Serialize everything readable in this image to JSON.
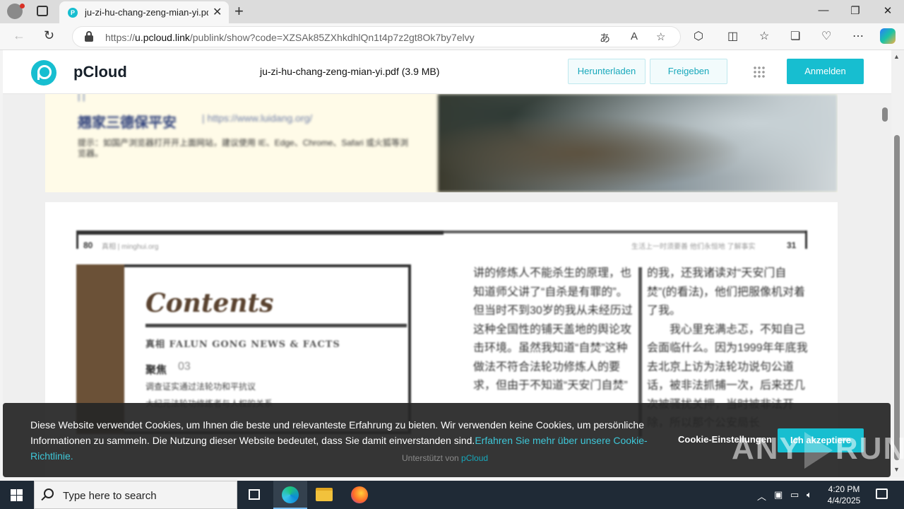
{
  "browser": {
    "tab_title": "ju-zi-hu-chang-zeng-mian-yi.pdf",
    "url_prefix": "https://",
    "url_domain": "u.pcloud.link",
    "url_rest": "/publink/show?code=XZSAk85ZXhkdhlQn1t4p7z2gt8Ok7by7elvy"
  },
  "header": {
    "logo_text": "pCloud",
    "file_title": "ju-zi-hu-chang-zeng-mian-yi.pdf (3.9 MB)",
    "download_label": "Herunterladen",
    "share_label": "Freigeben",
    "signin_label": "Anmelden"
  },
  "document": {
    "page1": {
      "line1": "|   |",
      "big_title": "翘家三德保平安",
      "url": "| https://www.luidang.org/",
      "note": "提示：如国产浏览器打开开上面网站，建议使用 IE、Edge、Chrome、Safari 或火狐等浏览器。"
    },
    "page2": {
      "page_num_left": "80",
      "header_left": "真相 | minghui.org",
      "header_right": "生活上一时须要善  他们永恒地 了解事实",
      "page_num_right": "31",
      "contents_title": "Contents",
      "subtitle": "真相 FALUN GONG NEWS & FACTS",
      "section": "聚焦",
      "section_num": "03",
      "item1": "调查证实通过法轮功和平抗议",
      "item2": "大纪元法轮功修炼者与人权的关系",
      "col1": "讲的修炼人不能杀生的原理，也知道师父讲了“自杀是有罪的”。但当时不到30岁的我从未经历过这种全国性的铺天盖地的舆论攻击环境。虽然我知道“自焚”这种做法不符合法轮功修炼人的要求，但由于不知道“天安门自焚”",
      "col2": "的我，还我诸读对“天安门自焚”(的看法)，他们把服像机对着了我。\n　　我心里充满忐忑，不知自己会面临什么。因为1999年年底我去北京上访为法轮功说句公道话，被非法抓捕一次，后来还几次被骚扰关押，当时被非法开除，所以那个公安局长"
    },
    "powered_prefix": "Unterstützt von",
    "powered_brand": "pCloud"
  },
  "cookie": {
    "text": "Diese Website verwendet Cookies, um Ihnen die beste und relevanteste Erfahrung zu bieten. Wir verwenden keine Cookies, um persönliche Informationen zu sammeln. Die Nutzung dieser Website bedeutet, dass Sie damit einverstanden sind.",
    "link": "Erfahren Sie mehr über unsere Cookie-Richtlinie.",
    "settings_label": "Cookie-Einstellungen",
    "accept_label": "Ich akzeptiere"
  },
  "watermark": {
    "left": "ANY",
    "right": "RUN"
  },
  "taskbar": {
    "search_placeholder": "Type here to search",
    "time": "4:20 PM",
    "date": "4/4/2025"
  },
  "colors": {
    "accent": "#17bed0",
    "banner_bg": "#262626",
    "taskbar_bg": "#1f2a36"
  }
}
